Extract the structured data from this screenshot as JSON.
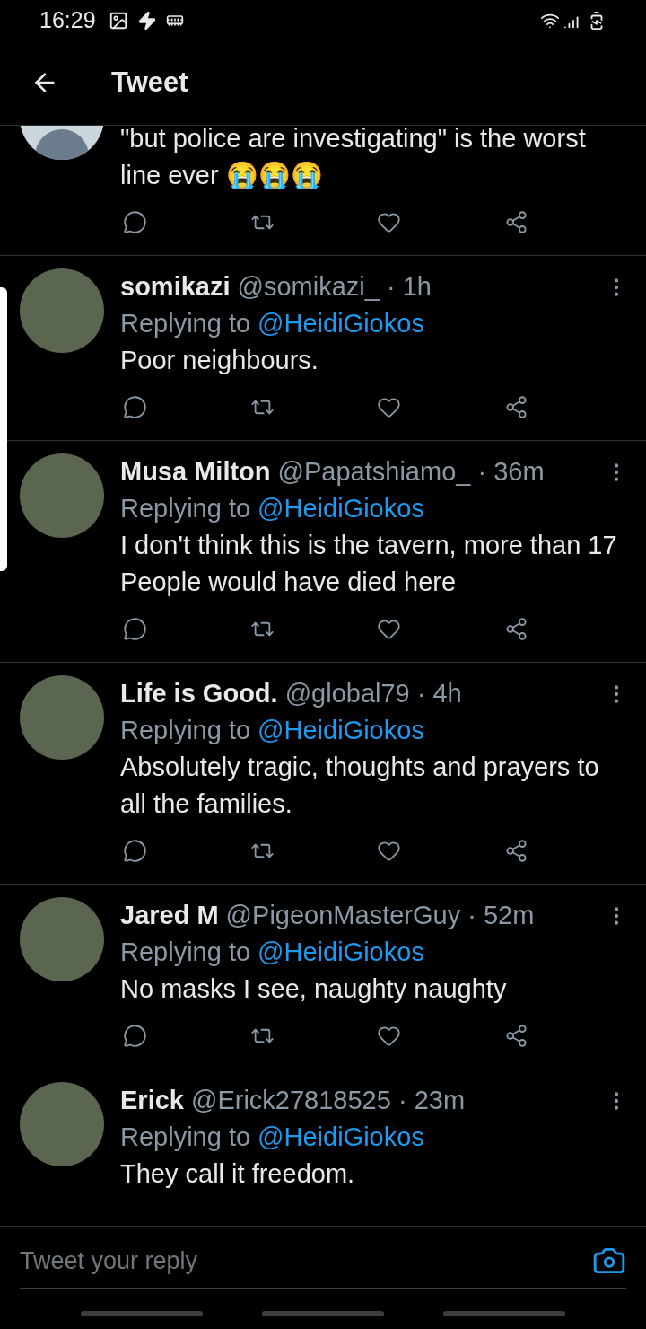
{
  "status_bar": {
    "time": "16:29"
  },
  "header": {
    "title": "Tweet"
  },
  "tweets": [
    {
      "kind": "partial",
      "default_avatar": true,
      "body": "\"but police are investigating\" is the worst line ever 😭😭😭"
    },
    {
      "kind": "full",
      "default_avatar": false,
      "name": "somikazi",
      "meta": "@somikazi_ · 1h",
      "replying_label": "Replying to",
      "mention": "@HeidiGiokos",
      "body": "Poor neighbours."
    },
    {
      "kind": "full",
      "default_avatar": false,
      "name": "Musa Milton",
      "meta": "@Papatshiamo_ · 36m",
      "replying_label": "Replying to",
      "mention": "@HeidiGiokos",
      "body": "I don't think this is the tavern, more than 17 People would have died here"
    },
    {
      "kind": "full",
      "default_avatar": false,
      "name": "Life is Good.",
      "meta": "@global79 · 4h",
      "replying_label": "Replying to",
      "mention": "@HeidiGiokos",
      "body": "Absolutely tragic, thoughts and prayers to all the families."
    },
    {
      "kind": "full",
      "default_avatar": false,
      "name": "Jared M",
      "meta": "@PigeonMasterGuy · 52m",
      "replying_label": "Replying to",
      "mention": "@HeidiGiokos",
      "body": "No masks I see, naughty naughty"
    },
    {
      "kind": "last",
      "default_avatar": false,
      "name": "Erick",
      "meta": "@Erick27818525 · 23m",
      "replying_label": "Replying to",
      "mention": "@HeidiGiokos",
      "body": "They call it freedom."
    }
  ],
  "reply_bar": {
    "placeholder": "Tweet your reply"
  }
}
